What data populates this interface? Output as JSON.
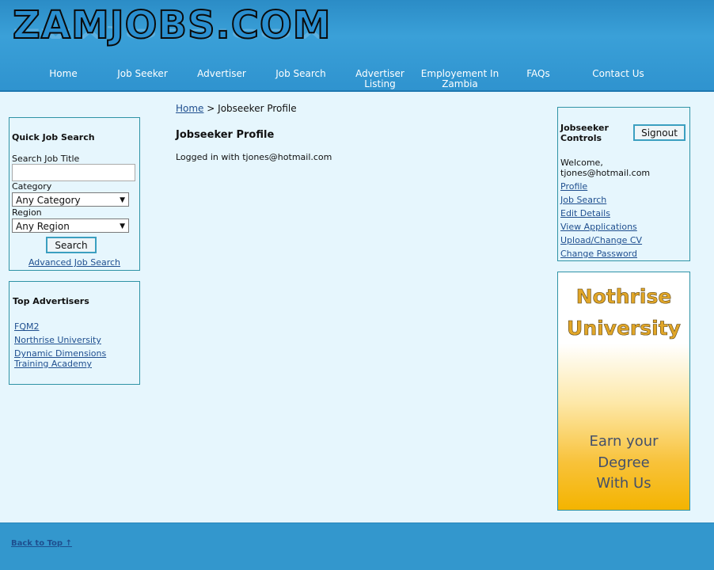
{
  "header": {
    "logo_text": "ZAMJOBS.COM",
    "nav": [
      {
        "label": "Home"
      },
      {
        "label": "Job Seeker"
      },
      {
        "label": "Advertiser"
      },
      {
        "label": "Job Search"
      },
      {
        "label": "Advertiser Listing"
      },
      {
        "label": "Employement In Zambia"
      },
      {
        "label": "FAQs"
      },
      {
        "label": "Contact Us"
      }
    ]
  },
  "breadcrumb": {
    "home": "Home",
    "separator": ">",
    "current": "Jobseeker Profile"
  },
  "main": {
    "title": "Jobseeker Profile",
    "logged_in": "Logged in with tjones@hotmail.com"
  },
  "quick_search": {
    "title": "Quick Job Search",
    "title_label": "Search Job Title",
    "title_value": "",
    "category_label": "Category",
    "category_selected": "Any Category",
    "region_label": "Region",
    "region_selected": "Any Region",
    "search_button": "Search",
    "advanced_link": "Advanced Job Search"
  },
  "top_advertisers": {
    "title": "Top Advertisers",
    "items": [
      "FQM2",
      "Northrise University",
      "Dynamic Dimensions Training Academy"
    ]
  },
  "controls": {
    "title": "Jobseeker Controls",
    "signout": "Signout",
    "welcome": "Welcome,",
    "email": "tjones@hotmail.com",
    "links": [
      "Profile",
      "Job Search",
      "Edit Details",
      "View Applications",
      "Upload/Change CV",
      "Change Password"
    ]
  },
  "ad": {
    "line1": "Nothrise",
    "line2": "University",
    "line3": "Earn your",
    "line4": "Degree",
    "line5": "With Us"
  },
  "footer": {
    "back_to_top": "Back to Top ↑"
  },
  "colors": {
    "header": "#3399d0",
    "page_bg": "#e6f6fd",
    "box_border": "#2f93a6",
    "link": "#1f4f8f"
  }
}
